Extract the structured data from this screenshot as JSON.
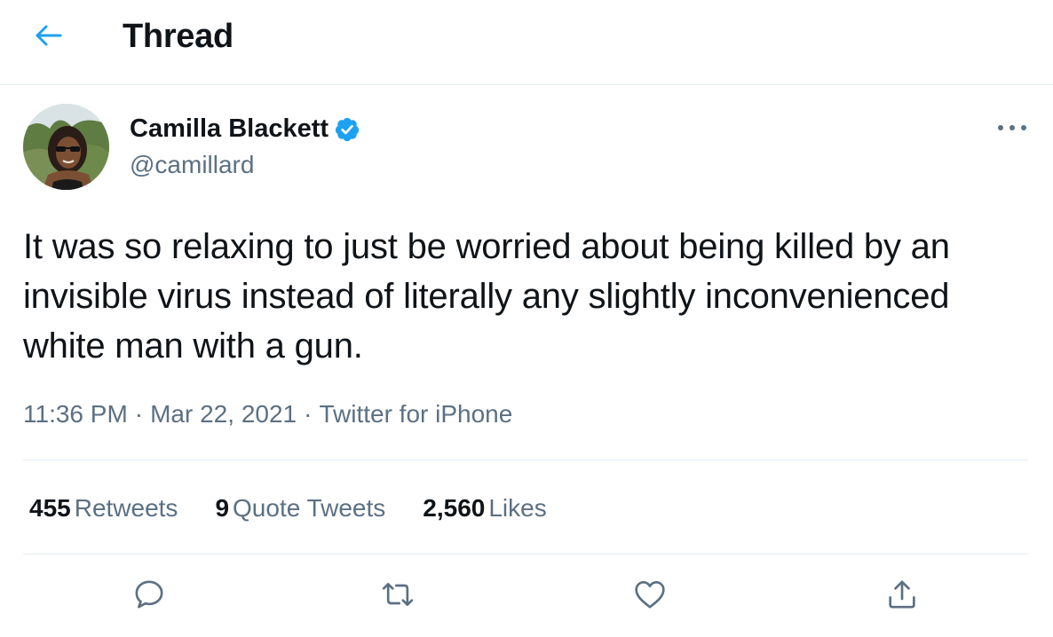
{
  "header": {
    "title": "Thread",
    "back_icon": "arrow-left-icon",
    "accent_color": "#1da1f2"
  },
  "tweet": {
    "author": {
      "name": "Camilla Blackett",
      "handle": "@camillard",
      "verified_icon": "verified-badge-icon",
      "avatar": "profile-photo"
    },
    "more_icon": "more-horizontal-icon",
    "text": "It was so relaxing to just be worried about being killed by an invisible virus instead of literally any slightly inconvenienced white man with a gun.",
    "time": "11:36 PM",
    "separator": "·",
    "date": "Mar 22, 2021",
    "source": "Twitter for iPhone",
    "stats": {
      "retweets": {
        "count": "455",
        "label": "Retweets"
      },
      "quote_tweets": {
        "count": "9",
        "label": "Quote Tweets"
      },
      "likes": {
        "count": "2,560",
        "label": "Likes"
      }
    },
    "actions": [
      "reply-icon",
      "retweet-icon",
      "like-icon",
      "share-icon"
    ]
  },
  "colors": {
    "text_primary": "#0f1419",
    "text_secondary": "#5b7083",
    "border": "#e6ecf0",
    "icon_gray": "#5b7083",
    "verified": "#1da1f2"
  }
}
